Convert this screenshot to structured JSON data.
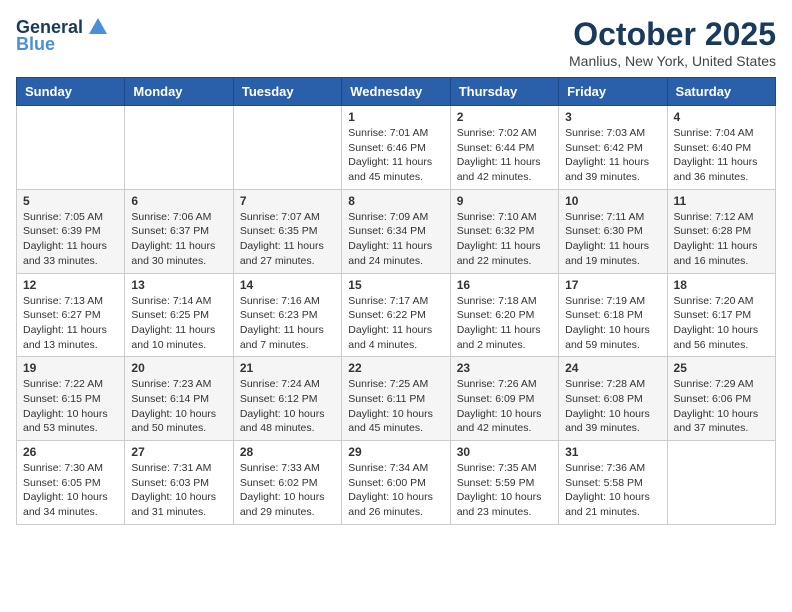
{
  "header": {
    "logo_general": "General",
    "logo_blue": "Blue",
    "month_title": "October 2025",
    "location": "Manlius, New York, United States"
  },
  "days_of_week": [
    "Sunday",
    "Monday",
    "Tuesday",
    "Wednesday",
    "Thursday",
    "Friday",
    "Saturday"
  ],
  "weeks": [
    [
      {
        "num": "",
        "info": ""
      },
      {
        "num": "",
        "info": ""
      },
      {
        "num": "",
        "info": ""
      },
      {
        "num": "1",
        "info": "Sunrise: 7:01 AM\nSunset: 6:46 PM\nDaylight: 11 hours\nand 45 minutes."
      },
      {
        "num": "2",
        "info": "Sunrise: 7:02 AM\nSunset: 6:44 PM\nDaylight: 11 hours\nand 42 minutes."
      },
      {
        "num": "3",
        "info": "Sunrise: 7:03 AM\nSunset: 6:42 PM\nDaylight: 11 hours\nand 39 minutes."
      },
      {
        "num": "4",
        "info": "Sunrise: 7:04 AM\nSunset: 6:40 PM\nDaylight: 11 hours\nand 36 minutes."
      }
    ],
    [
      {
        "num": "5",
        "info": "Sunrise: 7:05 AM\nSunset: 6:39 PM\nDaylight: 11 hours\nand 33 minutes."
      },
      {
        "num": "6",
        "info": "Sunrise: 7:06 AM\nSunset: 6:37 PM\nDaylight: 11 hours\nand 30 minutes."
      },
      {
        "num": "7",
        "info": "Sunrise: 7:07 AM\nSunset: 6:35 PM\nDaylight: 11 hours\nand 27 minutes."
      },
      {
        "num": "8",
        "info": "Sunrise: 7:09 AM\nSunset: 6:34 PM\nDaylight: 11 hours\nand 24 minutes."
      },
      {
        "num": "9",
        "info": "Sunrise: 7:10 AM\nSunset: 6:32 PM\nDaylight: 11 hours\nand 22 minutes."
      },
      {
        "num": "10",
        "info": "Sunrise: 7:11 AM\nSunset: 6:30 PM\nDaylight: 11 hours\nand 19 minutes."
      },
      {
        "num": "11",
        "info": "Sunrise: 7:12 AM\nSunset: 6:28 PM\nDaylight: 11 hours\nand 16 minutes."
      }
    ],
    [
      {
        "num": "12",
        "info": "Sunrise: 7:13 AM\nSunset: 6:27 PM\nDaylight: 11 hours\nand 13 minutes."
      },
      {
        "num": "13",
        "info": "Sunrise: 7:14 AM\nSunset: 6:25 PM\nDaylight: 11 hours\nand 10 minutes."
      },
      {
        "num": "14",
        "info": "Sunrise: 7:16 AM\nSunset: 6:23 PM\nDaylight: 11 hours\nand 7 minutes."
      },
      {
        "num": "15",
        "info": "Sunrise: 7:17 AM\nSunset: 6:22 PM\nDaylight: 11 hours\nand 4 minutes."
      },
      {
        "num": "16",
        "info": "Sunrise: 7:18 AM\nSunset: 6:20 PM\nDaylight: 11 hours\nand 2 minutes."
      },
      {
        "num": "17",
        "info": "Sunrise: 7:19 AM\nSunset: 6:18 PM\nDaylight: 10 hours\nand 59 minutes."
      },
      {
        "num": "18",
        "info": "Sunrise: 7:20 AM\nSunset: 6:17 PM\nDaylight: 10 hours\nand 56 minutes."
      }
    ],
    [
      {
        "num": "19",
        "info": "Sunrise: 7:22 AM\nSunset: 6:15 PM\nDaylight: 10 hours\nand 53 minutes."
      },
      {
        "num": "20",
        "info": "Sunrise: 7:23 AM\nSunset: 6:14 PM\nDaylight: 10 hours\nand 50 minutes."
      },
      {
        "num": "21",
        "info": "Sunrise: 7:24 AM\nSunset: 6:12 PM\nDaylight: 10 hours\nand 48 minutes."
      },
      {
        "num": "22",
        "info": "Sunrise: 7:25 AM\nSunset: 6:11 PM\nDaylight: 10 hours\nand 45 minutes."
      },
      {
        "num": "23",
        "info": "Sunrise: 7:26 AM\nSunset: 6:09 PM\nDaylight: 10 hours\nand 42 minutes."
      },
      {
        "num": "24",
        "info": "Sunrise: 7:28 AM\nSunset: 6:08 PM\nDaylight: 10 hours\nand 39 minutes."
      },
      {
        "num": "25",
        "info": "Sunrise: 7:29 AM\nSunset: 6:06 PM\nDaylight: 10 hours\nand 37 minutes."
      }
    ],
    [
      {
        "num": "26",
        "info": "Sunrise: 7:30 AM\nSunset: 6:05 PM\nDaylight: 10 hours\nand 34 minutes."
      },
      {
        "num": "27",
        "info": "Sunrise: 7:31 AM\nSunset: 6:03 PM\nDaylight: 10 hours\nand 31 minutes."
      },
      {
        "num": "28",
        "info": "Sunrise: 7:33 AM\nSunset: 6:02 PM\nDaylight: 10 hours\nand 29 minutes."
      },
      {
        "num": "29",
        "info": "Sunrise: 7:34 AM\nSunset: 6:00 PM\nDaylight: 10 hours\nand 26 minutes."
      },
      {
        "num": "30",
        "info": "Sunrise: 7:35 AM\nSunset: 5:59 PM\nDaylight: 10 hours\nand 23 minutes."
      },
      {
        "num": "31",
        "info": "Sunrise: 7:36 AM\nSunset: 5:58 PM\nDaylight: 10 hours\nand 21 minutes."
      },
      {
        "num": "",
        "info": ""
      }
    ]
  ]
}
